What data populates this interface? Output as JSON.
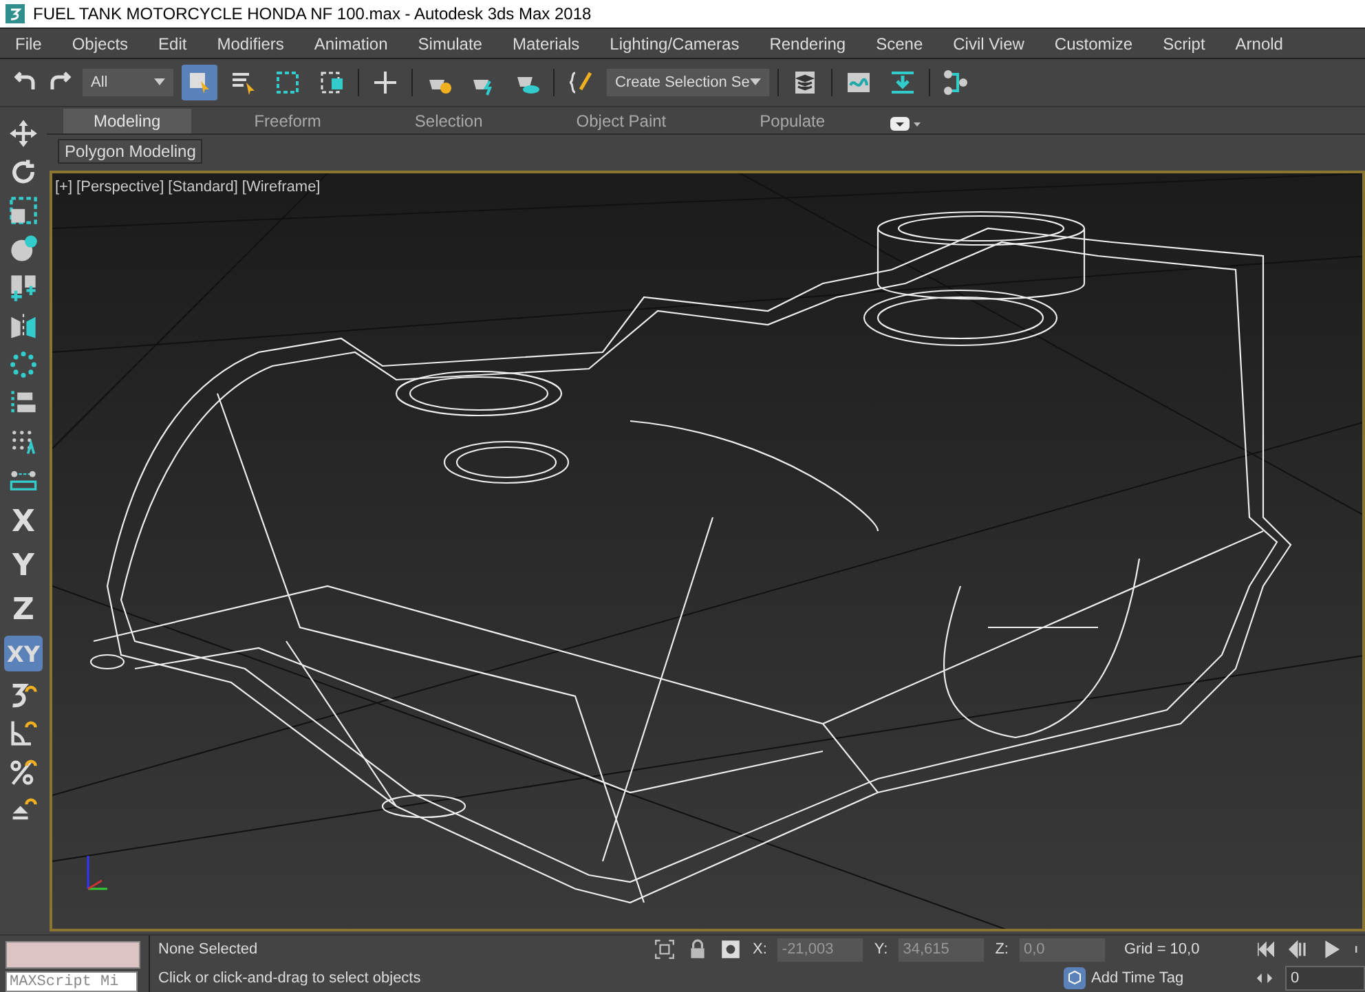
{
  "window": {
    "title": "FUEL TANK MOTORCYCLE HONDA NF 100.max - Autodesk 3ds Max 2018"
  },
  "menu": [
    "File",
    "Objects",
    "Edit",
    "Modifiers",
    "Animation",
    "Simulate",
    "Materials",
    "Lighting/Cameras",
    "Rendering",
    "Scene",
    "Civil View",
    "Customize",
    "Script",
    "Arnold"
  ],
  "toolbar": {
    "filter": "All",
    "selection_set": "Create Selection Se"
  },
  "ribbon": {
    "tabs": [
      {
        "label": "Modeling",
        "selected": true
      },
      {
        "label": "Freeform",
        "selected": false
      },
      {
        "label": "Selection",
        "selected": false
      },
      {
        "label": "Object Paint",
        "selected": false
      },
      {
        "label": "Populate",
        "selected": false
      }
    ],
    "panel": "Polygon Modeling"
  },
  "axis_buttons": [
    {
      "label": "X",
      "selected": false
    },
    {
      "label": "Y",
      "selected": false
    },
    {
      "label": "Z",
      "selected": false
    },
    {
      "label": "XY",
      "selected": true
    }
  ],
  "viewport": {
    "labels": [
      "[+]",
      "[Perspective]",
      "[Standard]",
      "[Wireframe]"
    ]
  },
  "status_bar": {
    "maxscript_placeholder": "MAXScript Mi",
    "selection": "None Selected",
    "prompt": "Click or click-and-drag to select objects",
    "coords": [
      {
        "axis": "X:",
        "value": "-21,003"
      },
      {
        "axis": "Y:",
        "value": "34,615"
      },
      {
        "axis": "Z:",
        "value": "0,0"
      }
    ],
    "grid": "Grid = 10,0",
    "time_tag": "Add Time Tag",
    "frame": "0"
  }
}
